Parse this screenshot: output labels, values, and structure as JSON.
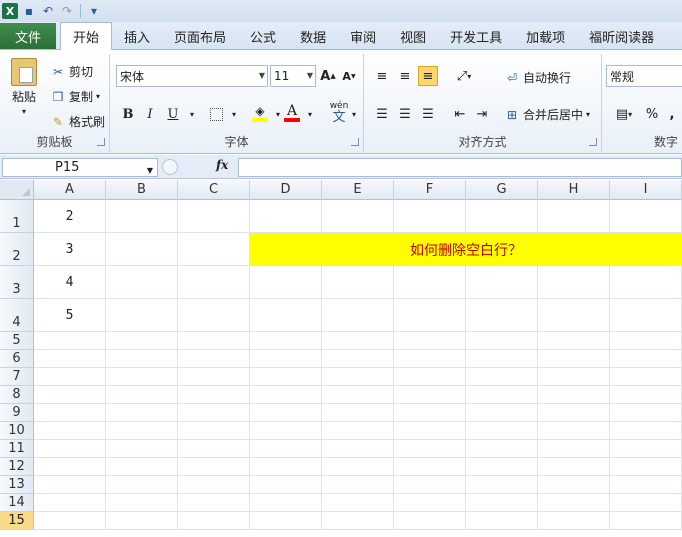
{
  "quick_access": {
    "app_icon": "X",
    "icons": [
      "save-icon",
      "undo-icon",
      "redo-icon",
      "customize-icon"
    ]
  },
  "tabs": [
    "文件",
    "开始",
    "插入",
    "页面布局",
    "公式",
    "数据",
    "审阅",
    "视图",
    "开发工具",
    "加载项",
    "福昕阅读器"
  ],
  "clipboard": {
    "paste": "粘贴",
    "cut": "剪切",
    "copy": "复制",
    "format_painter": "格式刷",
    "label": "剪贴板"
  },
  "font": {
    "name": "宋体",
    "size": "11",
    "label": "字体",
    "bold": "B",
    "italic": "I",
    "underline": "U",
    "wen": "wén",
    "wen2": "文",
    "grow": "A",
    "shrink": "A"
  },
  "alignment": {
    "wrap": "自动换行",
    "merge": "合并后居中",
    "label": "对齐方式"
  },
  "number": {
    "format": "常规",
    "percent": "%",
    "label": "数字"
  },
  "formula_bar": {
    "name_box": "P15",
    "fx": "fx",
    "content": ""
  },
  "columns": [
    "A",
    "B",
    "C",
    "D",
    "E",
    "F",
    "G",
    "H",
    "I"
  ],
  "rows": [
    "1",
    "2",
    "3",
    "4",
    "5",
    "6",
    "7",
    "8",
    "9",
    "10",
    "11",
    "12",
    "13",
    "14",
    "15"
  ],
  "cells": {
    "A1": "2",
    "A2": "3",
    "A3": "4",
    "A4": "5"
  },
  "highlight": {
    "text": "如何删除空白行？",
    "fill": "#ffff00",
    "color": "#c00000"
  },
  "selected_row": "15"
}
